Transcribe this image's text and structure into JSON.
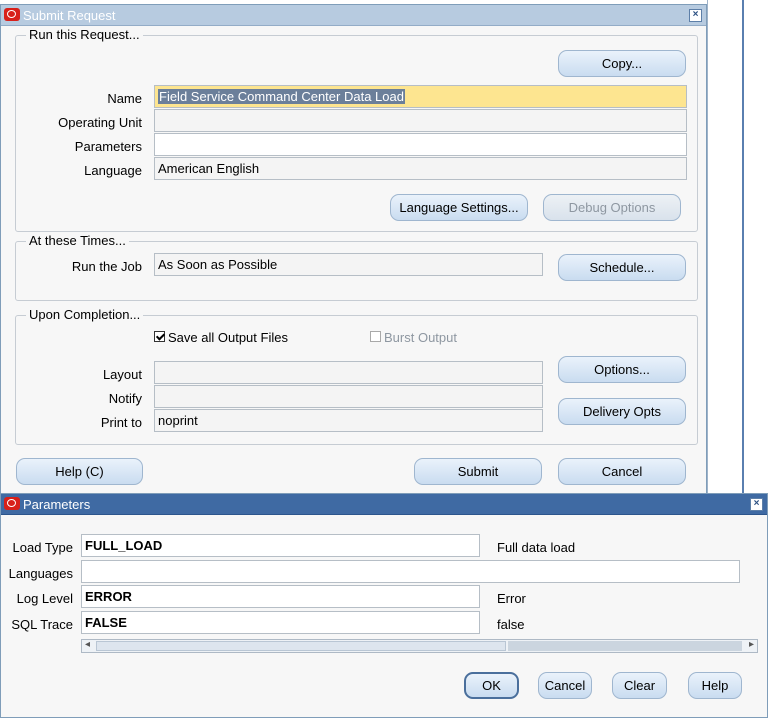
{
  "submit_request": {
    "title": "Submit Request",
    "run_group": {
      "title": "Run this Request...",
      "copy_label": "Copy...",
      "name_label": "Name",
      "name_value": "Field Service Command Center Data Load",
      "operating_unit_label": "Operating Unit",
      "operating_unit_value": "",
      "parameters_label": "Parameters",
      "parameters_value": "",
      "language_label": "Language",
      "language_value": "American English",
      "language_settings_label": "Language Settings...",
      "debug_options_label": "Debug Options"
    },
    "times_group": {
      "title": "At these Times...",
      "run_job_label": "Run the Job",
      "run_job_value": "As Soon as Possible",
      "schedule_label": "Schedule..."
    },
    "completion_group": {
      "title": "Upon Completion...",
      "save_output_label": "Save all Output Files",
      "save_output_checked": true,
      "burst_output_label": "Burst Output",
      "burst_output_checked": false,
      "layout_label": "Layout",
      "layout_value": "",
      "notify_label": "Notify",
      "notify_value": "",
      "print_to_label": "Print to",
      "print_to_value": "noprint",
      "options_label": "Options...",
      "delivery_label": "Delivery Opts"
    },
    "help_label": "Help (C)",
    "submit_label": "Submit",
    "cancel_label": "Cancel"
  },
  "parameters": {
    "title": "Parameters",
    "rows": [
      {
        "label": "Load Type",
        "value": "FULL_LOAD",
        "description": "Full data load"
      },
      {
        "label": "Languages",
        "value": "",
        "description": ""
      },
      {
        "label": "Log Level",
        "value": "ERROR",
        "description": "Error"
      },
      {
        "label": "SQL Trace",
        "value": "FALSE",
        "description": "false"
      }
    ],
    "ok_label": "OK",
    "cancel_label": "Cancel",
    "clear_label": "Clear",
    "help_label": "Help"
  }
}
